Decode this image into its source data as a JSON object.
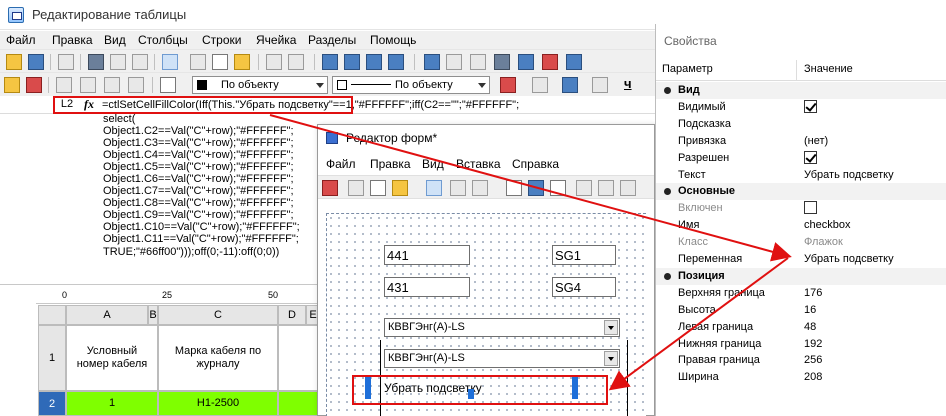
{
  "window": {
    "title": "Редактирование таблицы"
  },
  "menu": [
    "Файл",
    "Правка",
    "Вид",
    "Столбцы",
    "Строки",
    "Ячейка",
    "Разделы",
    "Помощь"
  ],
  "toolbar2": {
    "fill_combo": "По объекту",
    "line_combo": "По объекту",
    "underline": "ч"
  },
  "formula": {
    "cell_ref": "L2",
    "fx": "fx",
    "line1": "=ctlSetCellFillColor(Iff(This.\"Убрать подсветку\"==1,\"#FFFFFF\";iff(C2==\"\";\"#FFFFFF\";",
    "rest": "select(\nObject1.C2==Val(\"C\"+row);\"#FFFFFF\";\nObject1.C3==Val(\"C\"+row);\"#FFFFFF\";\nObject1.C4==Val(\"C\"+row);\"#FFFFFF\";\nObject1.C5==Val(\"C\"+row);\"#FFFFFF\";\nObject1.C6==Val(\"C\"+row);\"#FFFFFF\";\nObject1.C7==Val(\"C\"+row);\"#FFFFFF\";\nObject1.C8==Val(\"C\"+row);\"#FFFFFF\";\nObject1.C9==Val(\"C\"+row);\"#FFFFFF\";\nObject1.C10==Val(\"C\"+row);\"#FFFFFF\";\nObject1.C11==Val(\"C\"+row);\"#FFFFFF\";\nTRUE;\"#66ff00\")));off(0;-11):off(0;0))"
  },
  "sheet": {
    "ruler": [
      "0",
      "25",
      "50"
    ],
    "columns": [
      "A",
      "B",
      "C",
      "D",
      "E"
    ],
    "rows": [
      {
        "num": "1",
        "a": "Условный номер кабеля",
        "c": "Марка кабеля по журналу"
      },
      {
        "num": "2",
        "a": "1",
        "c": "H1-2500"
      }
    ],
    "highlight_color": "#7fff00"
  },
  "form_editor": {
    "title": "Редактор форм*",
    "menu": [
      "Файл",
      "Правка",
      "Вид",
      "Вставка",
      "Справка"
    ],
    "fields": [
      "441",
      "SG1",
      "431",
      "SG4"
    ],
    "dropdowns": [
      "КВВГЭнг(А)-LS",
      "КВВГЭнг(А)-LS"
    ],
    "checkbox_label": "Убрать подсветку"
  },
  "properties": {
    "title": "Свойства",
    "col_param": "Параметр",
    "col_value": "Значение",
    "rows": [
      {
        "type": "group",
        "key": "Вид"
      },
      {
        "type": "check",
        "key": "Видимый",
        "checked": true
      },
      {
        "type": "text",
        "key": "Подсказка",
        "value": ""
      },
      {
        "type": "text",
        "key": "Привязка",
        "value": "(нет)"
      },
      {
        "type": "check",
        "key": "Разрешен",
        "checked": true
      },
      {
        "type": "text",
        "key": "Текст",
        "value": "Убрать подсветку"
      },
      {
        "type": "group",
        "key": "Основные"
      },
      {
        "type": "check",
        "key": "Включен",
        "checked": false,
        "disabled": true
      },
      {
        "type": "text",
        "key": "Имя",
        "value": "checkbox"
      },
      {
        "type": "text",
        "key": "Класс",
        "value": "Флажок",
        "disabled": true
      },
      {
        "type": "text",
        "key": "Переменная",
        "value": "Убрать подсветку"
      },
      {
        "type": "group",
        "key": "Позиция"
      },
      {
        "type": "text",
        "key": "Верхняя граница",
        "value": "176"
      },
      {
        "type": "text",
        "key": "Высота",
        "value": "16"
      },
      {
        "type": "text",
        "key": "Левая граница",
        "value": "48"
      },
      {
        "type": "text",
        "key": "Нижняя граница",
        "value": "192"
      },
      {
        "type": "text",
        "key": "Правая граница",
        "value": "256"
      },
      {
        "type": "text",
        "key": "Ширина",
        "value": "208"
      }
    ]
  },
  "annotation_color": "#e01010"
}
